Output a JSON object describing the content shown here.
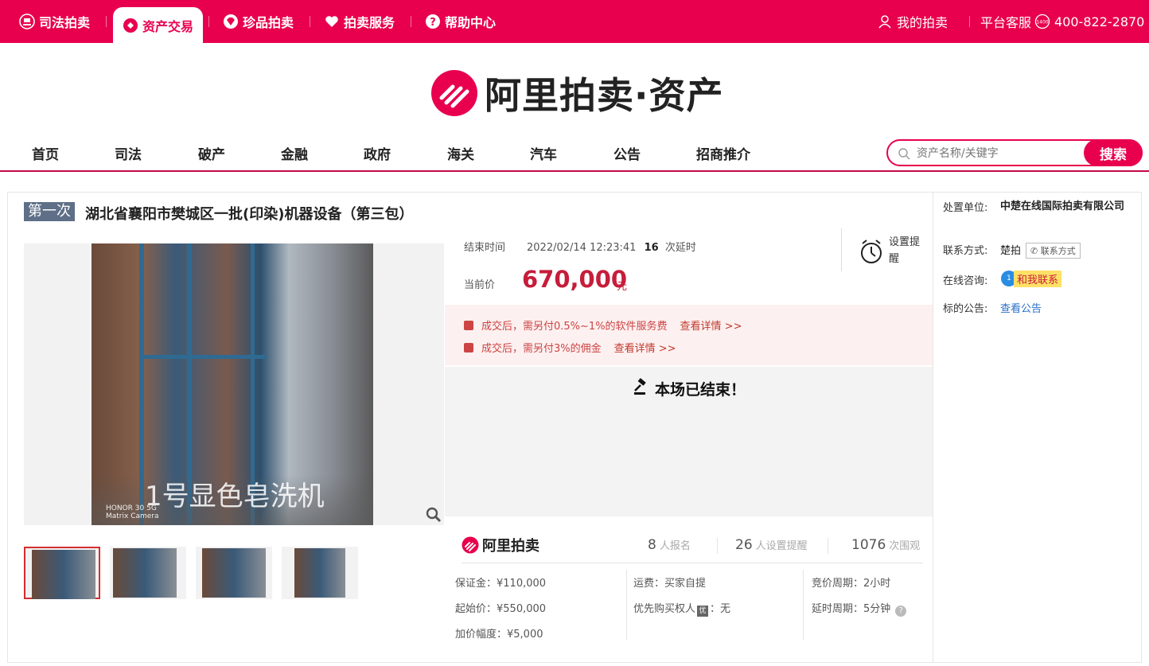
{
  "topbar": {
    "items": [
      {
        "label": "司法拍卖",
        "icon": "gavel-circle-icon"
      },
      {
        "label": "资产交易",
        "icon": "asset-icon"
      },
      {
        "label": "珍品拍卖",
        "icon": "diamond-icon"
      },
      {
        "label": "拍卖服务",
        "icon": "heart-icon"
      },
      {
        "label": "帮助中心",
        "icon": "question-icon"
      }
    ],
    "my_auction": "我的拍卖",
    "service_label": "平台客服",
    "phone": "400-822-2870",
    "phone_badge": "1400"
  },
  "logo": {
    "text": "阿里拍卖·资产"
  },
  "nav": [
    "首页",
    "司法",
    "破产",
    "金融",
    "政府",
    "海关",
    "汽车",
    "公告",
    "招商推介"
  ],
  "search": {
    "placeholder": "资产名称/关键字",
    "button": "搜索"
  },
  "item": {
    "round": "第一次",
    "title": "湖北省襄阳市樊城区一批(印染)机器设备（第三包）",
    "photo_caption": "1号显色皂洗机",
    "photo_watermark_1": "HONOR 30 5G",
    "photo_watermark_2": "Matrix Camera",
    "end_time_label": "结束时间",
    "end_time": "2022/02/14 12:23:41",
    "delay_count": "16",
    "delay_suffix": "次延时",
    "current_price_label": "当前价",
    "current_price": "670,000",
    "currency": "元",
    "remind_label": "设置提醒",
    "fees": [
      {
        "text": "成交后，需另付0.5%~1%的软件服务费",
        "link": "查看详情 >>"
      },
      {
        "text": "成交后，需另付3%的佣金",
        "link": "查看详情 >>"
      }
    ],
    "ended_text": "本场已结束！",
    "brand": "阿里拍卖",
    "stats": [
      {
        "value": "8",
        "unit": "人报名"
      },
      {
        "value": "26",
        "unit": "人设置提醒"
      },
      {
        "value": "1076",
        "unit": "次围观"
      }
    ],
    "details": {
      "deposit": "保证金：¥110,000",
      "start_price": "起始价：¥550,000",
      "increment": "加价幅度：¥5,000",
      "shipping": "运费：买家自提",
      "priority_label": "优先购买权人",
      "priority_badge": "优",
      "priority_value": "：无",
      "bid_period": "竞价周期：2小时",
      "delay_period": "延时周期：5分钟"
    }
  },
  "seller": {
    "unit_label": "处置单位:",
    "unit_value": "中楚在线国际拍卖有限公司",
    "contact_label": "联系方式:",
    "contact_name": "楚拍",
    "contact_button": "联系方式",
    "consult_label": "在线咨询:",
    "consult_badge": "1",
    "consult_button": "和我联系",
    "notice_label": "标的公告:",
    "notice_link": "查看公告"
  },
  "colors": {
    "brand": "#e8004e",
    "price": "#c61d3a",
    "badge": "#5e6f87",
    "link": "#2a6fc9"
  }
}
